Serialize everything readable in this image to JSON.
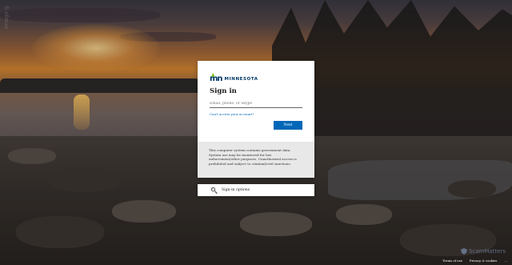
{
  "watermark": {
    "left": "Image g",
    "right": "ScamMatters"
  },
  "card": {
    "logo_text": "MINNESOTA",
    "title": "Sign in",
    "username_placeholder": "Email, phone, or Skype",
    "forgot_link": "Can't access your account?",
    "next_label": "Next"
  },
  "notice": {
    "text": "This computer system contains government data. System use may be monitored for law enforcement/other purposes. Unauthorized access is prohibited and subject to criminal/civil sanctions."
  },
  "signin_options": {
    "label": "Sign-in options",
    "icon": "key-icon"
  },
  "footer": {
    "terms": "Terms of use",
    "privacy": "Privacy & cookies",
    "more": "..."
  },
  "colors": {
    "accent": "#0067b8",
    "brand_blue": "#003865",
    "brand_green": "#78be21"
  }
}
